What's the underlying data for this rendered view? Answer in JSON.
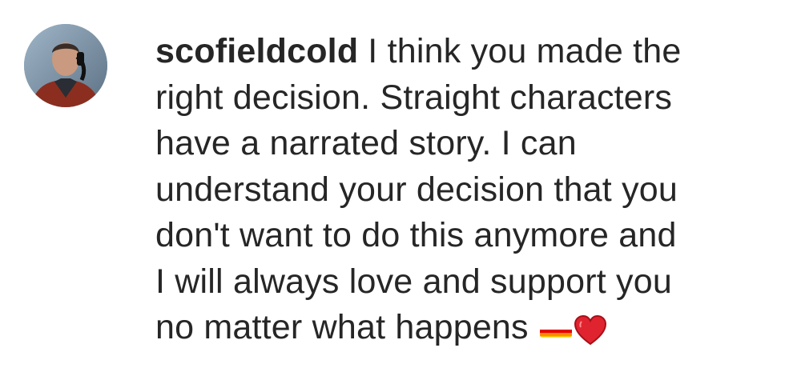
{
  "comment": {
    "username": "scofieldcold",
    "text_lines": [
      "I think you made the",
      "right decision. Straight characters",
      "have a narrated story. I can",
      "understand your decision that you",
      "don't want to do this anymore and",
      "I will always love and support you",
      "no matter what happens"
    ],
    "emojis": [
      "rainbow-flag-icon",
      "red-heart-icon"
    ]
  },
  "colors": {
    "text": "#262626",
    "background": "#ffffff",
    "heart": "#e0242f"
  }
}
